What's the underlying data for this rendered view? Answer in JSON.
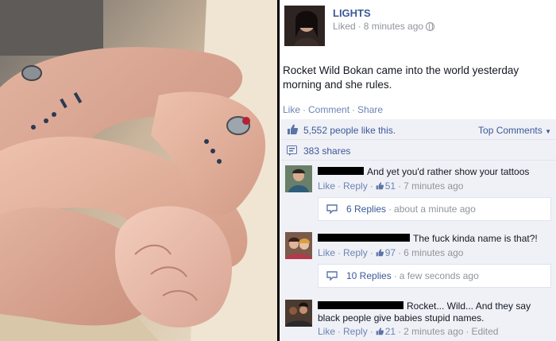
{
  "post": {
    "page_name": "LIGHTS",
    "liked_label": "Liked",
    "time": "8 minutes ago",
    "text": "Rocket Wild Bokan came into the world yesterday morning and she rules.",
    "actions": {
      "like": "Like",
      "comment": "Comment",
      "share": "Share"
    },
    "likes_text": "5,552 people like this.",
    "top_comments": "Top Comments",
    "shares_text": "383 shares"
  },
  "comments": [
    {
      "text": "And yet you'd rather show your tattoos",
      "like": "Like",
      "reply": "Reply",
      "like_count": "51",
      "time": "7 minutes ago",
      "replies": {
        "count": "6 Replies",
        "time": "about a minute ago"
      }
    },
    {
      "text": "The fuck kinda name is that?!",
      "like": "Like",
      "reply": "Reply",
      "like_count": "97",
      "time": "6 minutes ago",
      "replies": {
        "count": "10 Replies",
        "time": "a few seconds ago"
      }
    },
    {
      "text_line1": "Rocket... Wild... And they say",
      "text_line2": "black people give babies stupid names.",
      "like": "Like",
      "reply": "Reply",
      "like_count": "21",
      "time": "2 minutes ago",
      "edited": "Edited"
    }
  ],
  "icons": {
    "globe": "globe-icon",
    "thumb": "thumbs-up-icon",
    "share": "share-icon",
    "reply": "reply-icon",
    "chevron": "chevron-down-icon"
  },
  "colors": {
    "link": "#3b5998",
    "ufi_bg": "#eff1f6",
    "muted": "#90949c"
  }
}
